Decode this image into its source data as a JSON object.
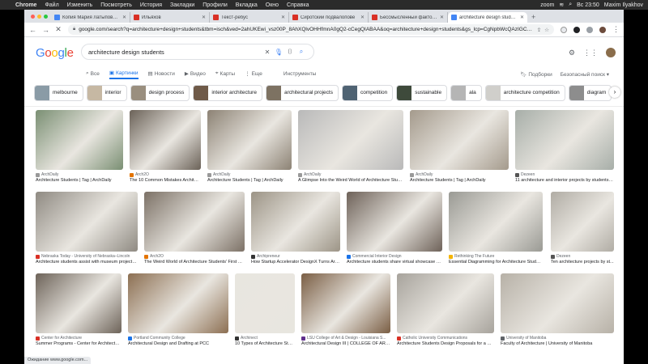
{
  "menubar": {
    "app": "Chrome",
    "items": [
      "Файл",
      "Изменить",
      "Посмотреть",
      "История",
      "Закладки",
      "Профили",
      "Вкладка",
      "Окно",
      "Справка"
    ],
    "right": [
      "zoom",
      "Вс 23:50",
      "Maxim Ilyakhov"
    ]
  },
  "tabs": [
    {
      "title": "Копия Мария Латыпова — кул",
      "color": "#4285f4"
    },
    {
      "title": "Ильяхов",
      "color": "#d93025"
    },
    {
      "title": "Текст-ребус",
      "color": "#d93025"
    },
    {
      "title": "Сиротский подвалопове",
      "color": "#d93025"
    },
    {
      "title": "Бессмысленный фактоид",
      "color": "#d93025"
    },
    {
      "title": "architecture design students",
      "color": "#4285f4",
      "active": true
    }
  ],
  "omnibox": {
    "url": "google.com/search?q=architecture+design+students&tbm=isch&ved=2ahUKEwi_vsz00P_8AhXQlvOHHfmnA0gQ2-cCegQIABAA&oq=architecture+design+students&gs_lcp=CgNpbWcQAzIGCAAQCBAeMgYIABAI..."
  },
  "google": {
    "logo": "Google",
    "query": "architecture design students",
    "tabs": [
      "Все",
      "Картинки",
      "Новости",
      "Видео",
      "Карты",
      "Еще"
    ],
    "tools": "Инструменты",
    "right_links": [
      "Подборки",
      "Безопасный поиск"
    ]
  },
  "chips": [
    {
      "label": "melbourne",
      "color": "#8a9ba6"
    },
    {
      "label": "interior",
      "color": "#c6b8a3"
    },
    {
      "label": "design process",
      "color": "#9a8f7f"
    },
    {
      "label": "interior architecture",
      "color": "#6f5a48"
    },
    {
      "label": "architectural projects",
      "color": "#7d7262"
    },
    {
      "label": "competition",
      "color": "#4f6373"
    },
    {
      "label": "sustainable",
      "color": "#3e4a3b"
    },
    {
      "label": "ala",
      "color": "#b5b5b5"
    },
    {
      "label": "architecture competition",
      "color": "#d0cfcb"
    },
    {
      "label": "diagram",
      "color": "#8d8d8d"
    }
  ],
  "results": [
    {
      "source": "ArchDaily",
      "caption": "Architecture Students | Tag | ArchDaily",
      "color": "#7a8f73",
      "fav": "#999"
    },
    {
      "source": "Arch2O",
      "caption": "The 10 Common Mistakes Architecture...",
      "color": "#6b6258",
      "fav": "#e37400"
    },
    {
      "source": "ArchDaily",
      "caption": "Architecture Students | Tag | ArchDaily",
      "color": "#8c8274",
      "fav": "#999"
    },
    {
      "source": "ArchDaily",
      "caption": "A Glimpse Into the Weird World of Architecture Stude...",
      "color": "#b9b9b9",
      "fav": "#999"
    },
    {
      "source": "ArchDaily",
      "caption": "Architecture Students | Tag | ArchDaily",
      "color": "#a49a8c",
      "fav": "#999"
    },
    {
      "source": "Dezeen",
      "caption": "11 architecture and interior projects by students a...",
      "color": "#a7aea8",
      "fav": "#555"
    },
    {
      "source": "Nebraska Today - University of Nebraska–Lincoln",
      "caption": "Architecture students assist with museum project | ...",
      "color": "#8f8a82",
      "fav": "#d93025"
    },
    {
      "source": "Arch2O",
      "caption": "The Weird World of Architecture Students' First Aus...",
      "color": "#7c7166",
      "fav": "#e37400"
    },
    {
      "source": "Archipreneur",
      "caption": "How Startup Accelerator DesignX Turns Arch...",
      "color": "#9c9486",
      "fav": "#333"
    },
    {
      "source": "Commercial Interior Design",
      "caption": "Architecture students share virtual showcase of t...",
      "color": "#6e6259",
      "fav": "#1a73e8"
    },
    {
      "source": "Rethinking The Future",
      "caption": "Essential Diagramming for Architecture Studen...",
      "color": "#9a9a94",
      "fav": "#f4b400"
    },
    {
      "source": "Dezeen",
      "caption": "Ten architecture projects by st...",
      "color": "#b0aca4",
      "fav": "#555"
    },
    {
      "source": "Center for Architecture",
      "caption": "Summer Programs - Center for Architecture",
      "color": "#6d6359",
      "fav": "#d93025"
    },
    {
      "source": "Portland Community College",
      "caption": "Architectural Design and Drafting at PCC",
      "color": "#8c6f52",
      "fav": "#1a73e8"
    },
    {
      "source": "Archinect",
      "caption": "10 Types of Architecture Stude...",
      "color": "#e8e6df",
      "fav": "#333"
    },
    {
      "source": "LSU College of Art & Design - Louisiana S...",
      "caption": "Architectural Design III | COLLEGE OF ART &...",
      "color": "#7a5e44",
      "fav": "#5f2e8c"
    },
    {
      "source": "Catholic University Communications",
      "caption": "Architecture Students Design Proposals for a Ne...",
      "color": "#a7a39c",
      "fav": "#d93025"
    },
    {
      "source": "University of Manitoba",
      "caption": "Faculty of Architecture | University of Manitoba",
      "color": "#b7b1a7",
      "fav": "#5f6368"
    }
  ],
  "statusbar": "Ожидание www.google.com..."
}
